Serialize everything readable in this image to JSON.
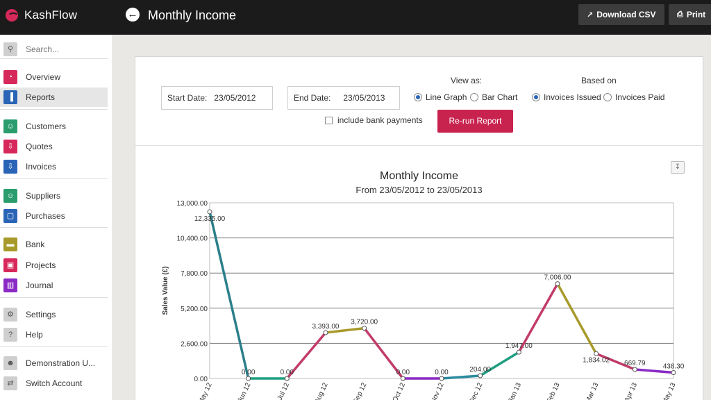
{
  "topbar": {
    "brand": "KashFlow",
    "title": "Monthly Income",
    "download_csv": "Download CSV",
    "print": "Print"
  },
  "sidebar": {
    "search_placeholder": "Search...",
    "items": [
      {
        "label": "Overview",
        "icon": "gauge-icon",
        "color": "#d6285a"
      },
      {
        "label": "Reports",
        "icon": "bar-chart-icon",
        "color": "#2a64b6"
      },
      {
        "label": "Customers",
        "icon": "people-icon",
        "color": "#2a9d6e"
      },
      {
        "label": "Quotes",
        "icon": "quote-icon",
        "color": "#d6285a"
      },
      {
        "label": "Invoices",
        "icon": "invoice-icon",
        "color": "#2a64b6"
      },
      {
        "label": "Suppliers",
        "icon": "people-icon",
        "color": "#2a9d6e"
      },
      {
        "label": "Purchases",
        "icon": "purchase-icon",
        "color": "#2a64b6"
      },
      {
        "label": "Bank",
        "icon": "bank-icon",
        "color": "#a89a2a"
      },
      {
        "label": "Projects",
        "icon": "briefcase-icon",
        "color": "#d6285a"
      },
      {
        "label": "Journal",
        "icon": "journal-icon",
        "color": "#8a2ac4"
      },
      {
        "label": "Settings",
        "icon": "gear-icon",
        "color": "#cfcfcf"
      },
      {
        "label": "Help",
        "icon": "help-icon",
        "color": "#cfcfcf"
      },
      {
        "label": "Demonstration U...",
        "icon": "user-icon",
        "color": "#cfcfcf"
      },
      {
        "label": "Switch Account",
        "icon": "switch-icon",
        "color": "#cfcfcf"
      }
    ]
  },
  "filters": {
    "start_label": "Start Date:",
    "start_value": "23/05/2012",
    "end_label": "End Date:",
    "end_value": "23/05/2013",
    "view_as": "View as:",
    "based_on": "Based on",
    "line_graph": "Line Graph",
    "bar_chart": "Bar Chart",
    "invoices_issued": "Invoices Issued",
    "invoices_paid": "Invoices Paid",
    "include_bank": "include bank payments",
    "rerun": "Re-run Report"
  },
  "chart_data": {
    "type": "line",
    "title": "Monthly Income",
    "subtitle": "From 23/05/2012 to 23/05/2013",
    "ylabel": "Sales Value (£)",
    "xlabel": "",
    "ylim": [
      0,
      13000
    ],
    "yticks": [
      "0.00",
      "2,600.00",
      "5,200.00",
      "7,800.00",
      "10,400.00",
      "13,000.00"
    ],
    "categories": [
      "May 12",
      "Jun 12",
      "Jul 12",
      "Aug 12",
      "Sep 12",
      "Oct 12",
      "Nov 12",
      "Dec 12",
      "Jan 13",
      "Feb 13",
      "Mar 13",
      "Apr 13",
      "May 13"
    ],
    "values": [
      12335,
      0,
      0,
      3393,
      3720,
      0,
      0,
      204,
      1947,
      7006,
      1834.02,
      669.79,
      438.3
    ],
    "value_labels": [
      "12,335.00",
      "0.00",
      "0.00",
      "3,393.00",
      "3,720.00",
      "0.00",
      "0.00",
      "204.00",
      "1,947.00",
      "7,006.00",
      "1,834.02",
      "669.79",
      "438.30"
    ],
    "segment_colors": [
      "#2b7f8a",
      "#1f9e80",
      "#c23b6a",
      "#a89a2a",
      "#c23b6a",
      "#8a2ac4",
      "#2b8aa0",
      "#1f9e80",
      "#c23b6a",
      "#a89a2a",
      "#c23b6a",
      "#8a2ac4"
    ],
    "grid": true
  }
}
